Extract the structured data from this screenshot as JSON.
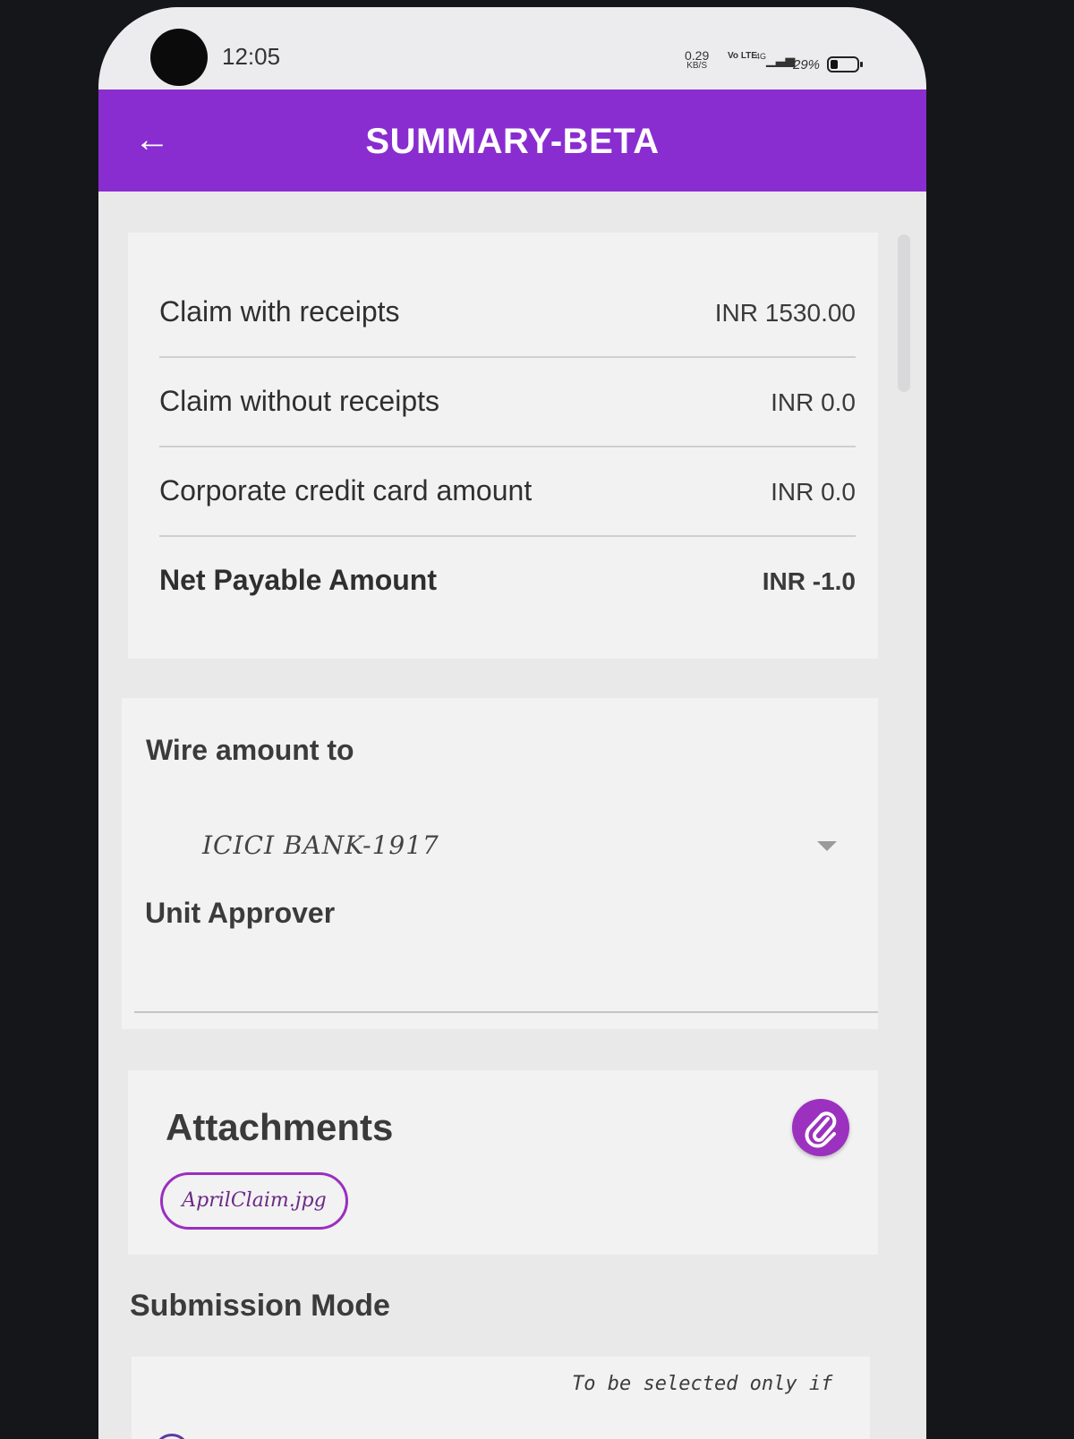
{
  "status_bar": {
    "time": "12:05",
    "net_speed": "0.29",
    "net_speed_unit": "KB/S",
    "network_tag": "Vo LTE",
    "signal_type": "4G",
    "battery_percent": "29%",
    "battery_level": 0.29
  },
  "app_bar": {
    "title": "SUMMARY-BETA",
    "background": "#8a2dd0",
    "back_icon": "arrow-left-icon"
  },
  "summary": {
    "rows": [
      {
        "label": "Claim with receipts",
        "value": "INR 1530.00"
      },
      {
        "label": "Claim without receipts",
        "value": "INR 0.0"
      },
      {
        "label": "Corporate credit card amount",
        "value": "INR 0.0"
      },
      {
        "label": "Net Payable Amount",
        "value": "INR -1.0"
      }
    ]
  },
  "wire": {
    "label": "Wire amount to",
    "selected_bank": "ICICI BANK-1917",
    "dropdown_icon": "caret-down-icon",
    "approver_label": "Unit Approver",
    "approver_value": ""
  },
  "attachments": {
    "title": "Attachments",
    "attach_icon": "paperclip-icon",
    "accent": "#9c31bf",
    "files": [
      "AprilClaim.jpg"
    ]
  },
  "submission": {
    "title": "Submission Mode",
    "note": "To be selected only if"
  }
}
